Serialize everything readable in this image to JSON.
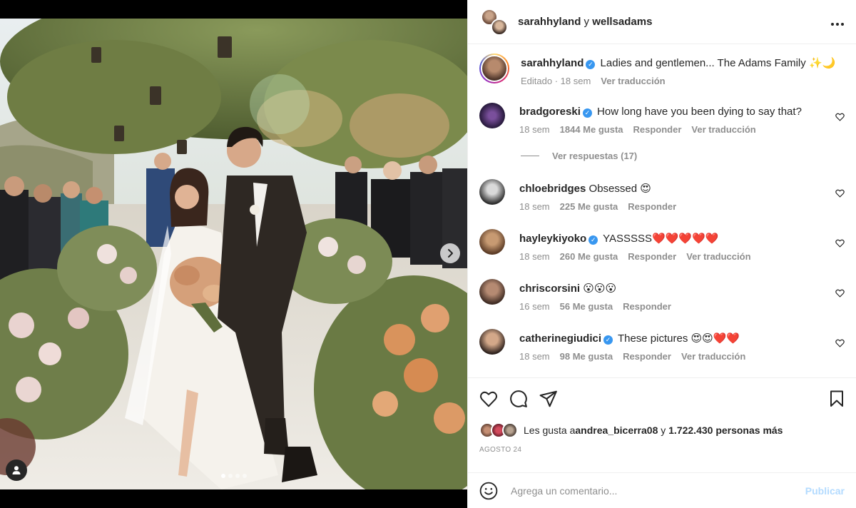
{
  "post": {
    "slide_count": 4,
    "active_slide": 1
  },
  "header": {
    "user1": "sarahhyland",
    "connector": " y ",
    "user2": "wellsadams",
    "more_icon": "more-horizontal-icon"
  },
  "caption": {
    "user": "sarahhyland",
    "text": "Ladies and gentlemen... The Adams Family ",
    "emoji": "✨🌙",
    "edited": "Editado · 18 sem",
    "translate": "Ver traducción"
  },
  "comments": [
    {
      "user": "bradgoreski",
      "verified": true,
      "text": "How long have you been dying to say that?",
      "emoji": "",
      "time": "18 sem",
      "likes": "1844 Me gusta",
      "reply": "Responder",
      "translate": "Ver traducción",
      "replies": "Ver respuestas (17)"
    },
    {
      "user": "chloebridges",
      "verified": false,
      "text": "Obsessed ",
      "emoji": "😍",
      "time": "18 sem",
      "likes": "225 Me gusta",
      "reply": "Responder"
    },
    {
      "user": "hayleykiyoko",
      "verified": true,
      "text": "YASSSSS",
      "emoji": "❤️❤️❤️❤️❤️",
      "time": "18 sem",
      "likes": "260 Me gusta",
      "reply": "Responder",
      "translate": "Ver traducción"
    },
    {
      "user": "chriscorsini",
      "verified": false,
      "text": "",
      "emoji": "😮😮😮",
      "time": "16 sem",
      "likes": "56 Me gusta",
      "reply": "Responder"
    },
    {
      "user": "catherinegiudici",
      "verified": true,
      "text": "These pictures ",
      "emoji": "😍😍❤️❤️",
      "time": "18 sem",
      "likes": "98 Me gusta",
      "reply": "Responder",
      "translate": "Ver traducción"
    }
  ],
  "likes": {
    "prefix": "Les gusta a ",
    "user": "andrea_bicerra08",
    "middle": " y ",
    "count": "1.722.430 personas más"
  },
  "date": "AGOSTO 24",
  "add_comment": {
    "placeholder": "Agrega un comentario...",
    "post_label": "Publicar"
  },
  "colors": {
    "verified": "#3897f0",
    "post_disabled": "#b3dbff",
    "muted": "#8e8e8e"
  }
}
